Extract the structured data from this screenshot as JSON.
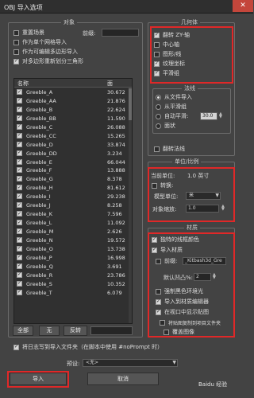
{
  "window": {
    "title": "OBJ 导入选项",
    "close_glyph": "✕"
  },
  "objects": {
    "title": "对象",
    "rename_groups": "重置场景",
    "prefix_label": "前缀:",
    "single_mesh": "作为单个网格导入",
    "editable_poly": "作为可编辑多边形导入",
    "retriangulate": "对多边形重新划分三角形",
    "list": {
      "col_name": "名称",
      "col_faces": "面",
      "items": [
        {
          "name": "Greeble_A",
          "faces": "30.672"
        },
        {
          "name": "Greeble_AA",
          "faces": "21.876"
        },
        {
          "name": "Greeble_B",
          "faces": "22.624"
        },
        {
          "name": "Greeble_BB",
          "faces": "11.590"
        },
        {
          "name": "Greeble_C",
          "faces": "26.088"
        },
        {
          "name": "Greeble_CC",
          "faces": "15.265"
        },
        {
          "name": "Greeble_D",
          "faces": "33.874"
        },
        {
          "name": "Greeble_DD",
          "faces": "3.234"
        },
        {
          "name": "Greeble_E",
          "faces": "66.044"
        },
        {
          "name": "Greeble_F",
          "faces": "13.888"
        },
        {
          "name": "Greeble_G",
          "faces": "8.378"
        },
        {
          "name": "Greeble_H",
          "faces": "81.612"
        },
        {
          "name": "Greeble_I",
          "faces": "29.238"
        },
        {
          "name": "Greeble_J",
          "faces": "8.258"
        },
        {
          "name": "Greeble_K",
          "faces": "7.596"
        },
        {
          "name": "Greeble_L",
          "faces": "11.092"
        },
        {
          "name": "Greeble_M",
          "faces": "2.626"
        },
        {
          "name": "Greeble_N",
          "faces": "19.572"
        },
        {
          "name": "Greeble_O",
          "faces": "13.738"
        },
        {
          "name": "Greeble_P",
          "faces": "16.998"
        },
        {
          "name": "Greeble_Q",
          "faces": "3.691"
        },
        {
          "name": "Greeble_R",
          "faces": "23.786"
        },
        {
          "name": "Greeble_S",
          "faces": "10.352"
        },
        {
          "name": "Greeble_T",
          "faces": "6.079"
        }
      ]
    },
    "btn_all": "全部",
    "btn_none": "无",
    "btn_invert": "反转"
  },
  "geometry": {
    "title": "几何体",
    "flip_zy": "翻转 ZY-轴",
    "center_pivots": "中心轴",
    "shapes_lines": "图形/线",
    "texture_coords": "纹理坐标",
    "smooth_groups": "平滑组",
    "normals": {
      "title": "法线",
      "from_file": "从文件导入",
      "from_sm": "从平滑组",
      "auto_smooth": "自动平滑:",
      "auto_smooth_value": "30.0",
      "faceted": "面状",
      "flip_normals": "翻转法线"
    }
  },
  "units": {
    "title": "单位/比例",
    "current_unit_label": "当前单位:",
    "current_unit_value": "1.0 英寸",
    "convert": "转换:",
    "model_unit_label": "模型单位:",
    "model_unit_value": "米",
    "scale_label": "对象缩放:",
    "scale_value": "1.0"
  },
  "materials": {
    "title": "材质",
    "unique_wire_color": "独特的线框颜色",
    "import_materials": "导入材质",
    "prefix": "前缀:",
    "prefix_value": "_Kitbash3d_Gre",
    "default_bump_label": "默认凹凸%:",
    "default_bump_value": "2",
    "force_black_ambient": "强制黑色环境光",
    "import_into_editor": "导入到材质编辑器",
    "show_maps_viewport": "在视口中显示贴图",
    "copy_maps_project": "将贴图复制到项目文件夹",
    "overwrite_images": "覆盖图像"
  },
  "footer": {
    "log_checkbox": "将日志写到导入文件夹（在脚本中使用 #noPrompt 时）",
    "preset_label": "预设:",
    "preset_value": "<无>",
    "import_button": "导入",
    "cancel_button": "取消",
    "watermark": "Baidu 经验"
  },
  "colors": {
    "highlight": "#e02828",
    "background": "#434343"
  }
}
